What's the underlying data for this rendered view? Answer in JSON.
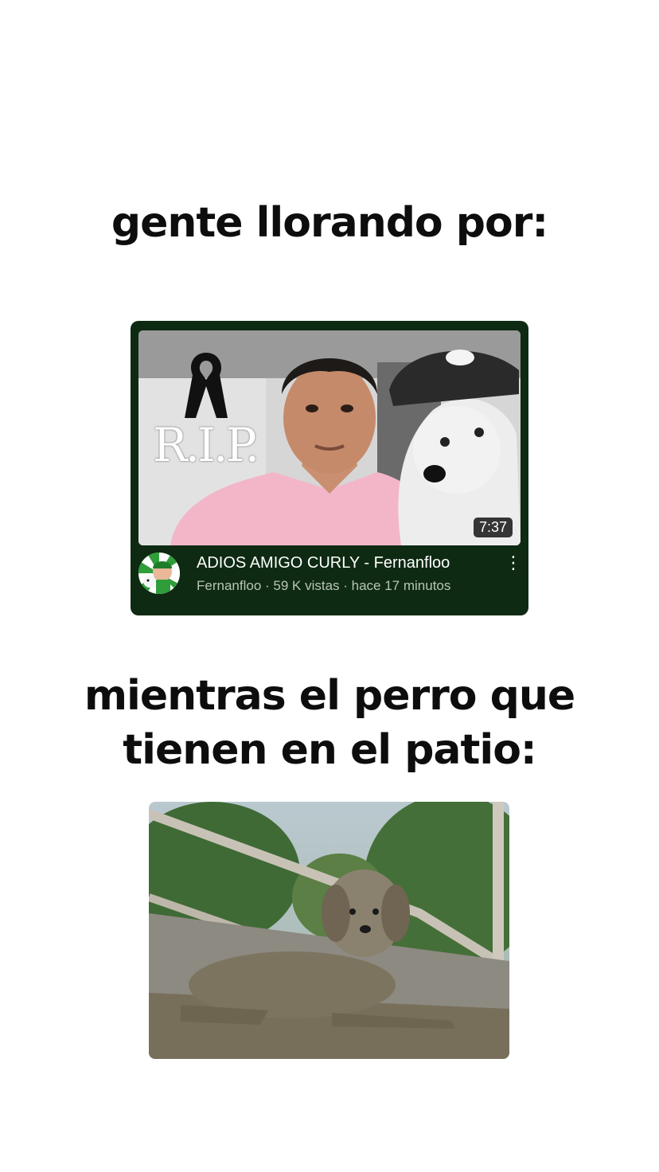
{
  "captions": {
    "top": "gente llorando por:",
    "bottom_line1": "mientras el perro que",
    "bottom_line2": "tienen en el patio:"
  },
  "video": {
    "overlay_text": "R.I.P.",
    "duration": "7:37",
    "title": "ADIOS AMIGO CURLY - Fernanfloo",
    "meta": "Fernanfloo · 59 K vistas · hace 17 minutos",
    "more_icon": "⋮",
    "card_color": "#0e2a12"
  }
}
